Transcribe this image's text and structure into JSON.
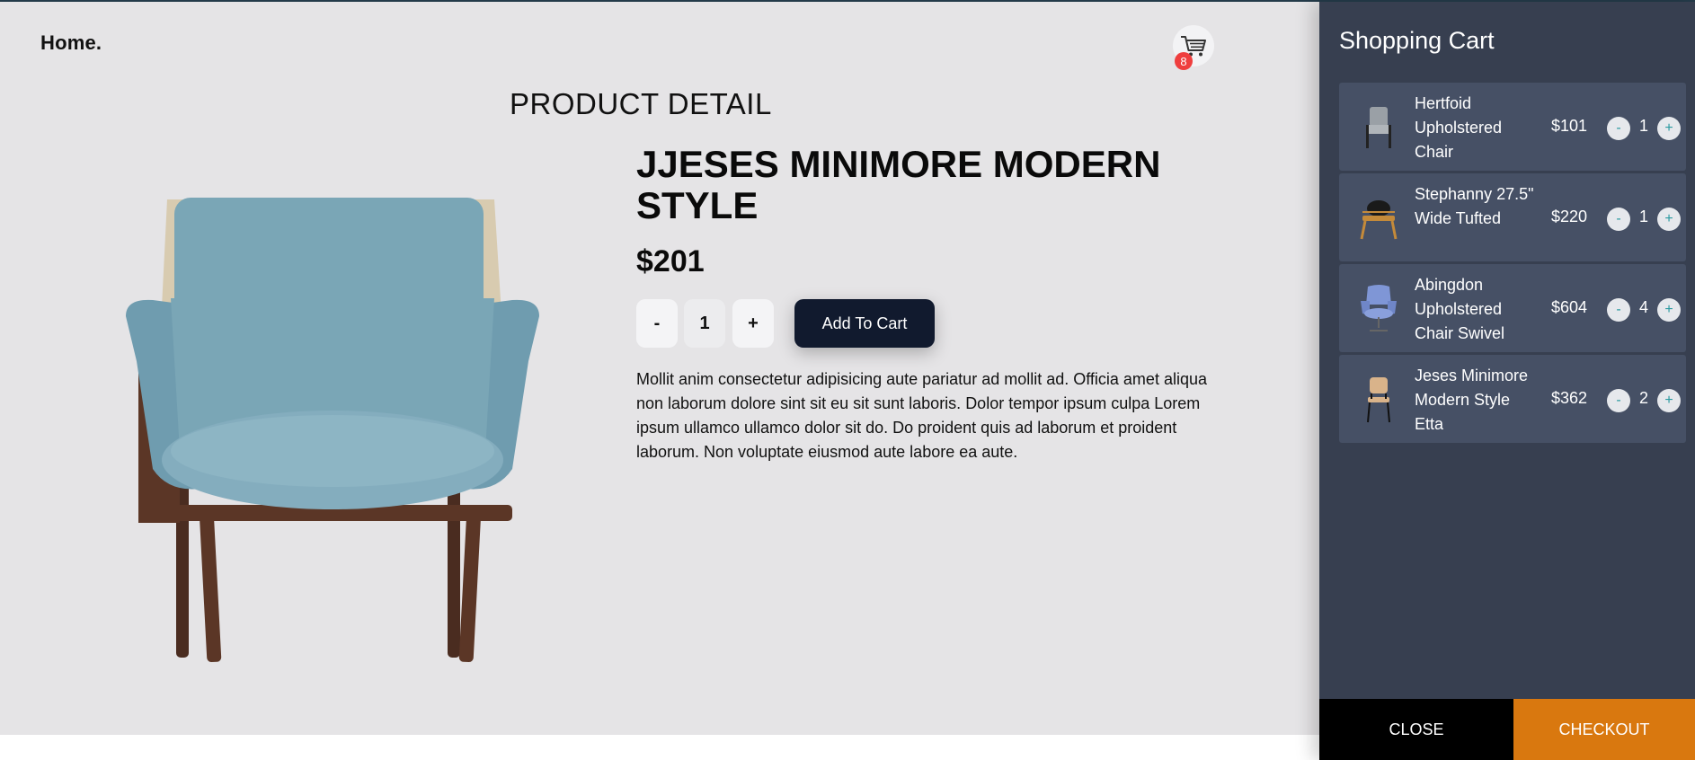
{
  "header": {
    "brand": "Home.",
    "cart_badge_count": "8",
    "cart_icon": "shopping-cart-icon"
  },
  "page": {
    "heading": "PRODUCT DETAIL"
  },
  "product": {
    "title": "JJESES MINIMORE MODERN STYLE",
    "price": "$201",
    "qty_minus_label": "-",
    "qty_value": "1",
    "qty_plus_label": "+",
    "add_to_cart_label": "Add To Cart",
    "description": "Mollit anim consectetur adipisicing aute pariatur ad mollit ad. Officia amet aliqua non laborum dolore sint sit eu sit sunt laboris. Dolor tempor ipsum culpa Lorem ipsum ullamco ullamco dolor sit do. Do proident quis ad laborum et proident laborum. Non voluptate eiusmod aute labore ea aute."
  },
  "cart": {
    "title": "Shopping Cart",
    "items": [
      {
        "name": "Hertfoid Upholstered Chair",
        "price": "$101",
        "qty": "1",
        "minus": "-",
        "plus": "+"
      },
      {
        "name": "Stephanny 27.5\" Wide Tufted",
        "price": "$220",
        "qty": "1",
        "minus": "-",
        "plus": "+"
      },
      {
        "name": "Abingdon Upholstered Chair Swivel",
        "price": "$604",
        "qty": "4",
        "minus": "-",
        "plus": "+"
      },
      {
        "name": "Jeses Minimore Modern Style Etta",
        "price": "$362",
        "qty": "2",
        "minus": "-",
        "plus": "+"
      }
    ],
    "close_label": "CLOSE",
    "checkout_label": "CHECKOUT"
  },
  "colors": {
    "panel_bg": "#373f50",
    "item_bg": "#465065",
    "checkout": "#d9780f",
    "badge": "#ef3e3e",
    "primary_button": "#111a2e"
  }
}
